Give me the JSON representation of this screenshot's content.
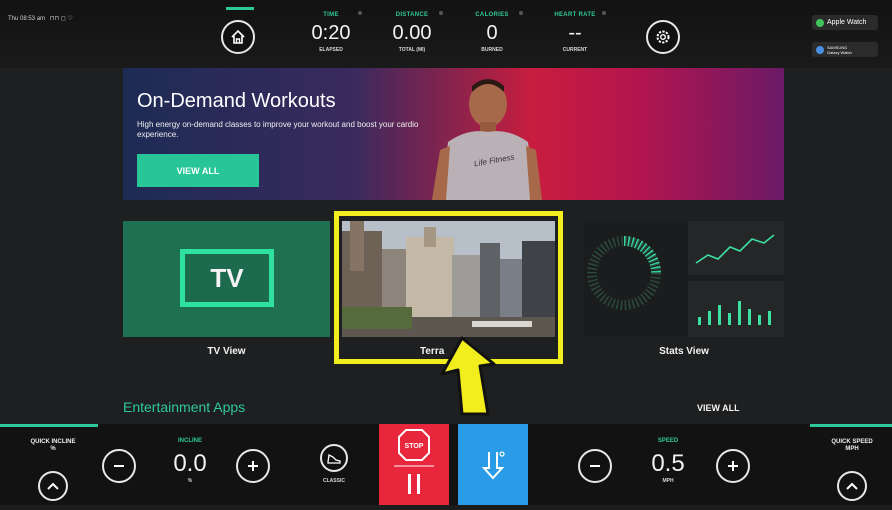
{
  "system": {
    "status_text": "Thu 08:53 am"
  },
  "stats": [
    {
      "label": "TIME",
      "value": "0:20",
      "sub": "ELAPSED"
    },
    {
      "label": "DISTANCE",
      "value": "0.00",
      "sub": "TOTAL (MI)"
    },
    {
      "label": "CALORIES",
      "value": "0",
      "sub": "BURNED"
    },
    {
      "label": "HEART RATE",
      "value": "--",
      "sub": "CURRENT"
    }
  ],
  "watches": {
    "apple": "Apple Watch",
    "samsung_line1": "SAMSUNG",
    "samsung_line2": "Galaxy Watch"
  },
  "hero": {
    "title": "On-Demand Workouts",
    "description": "High energy on-demand classes to improve your workout and boost your cardio experience.",
    "button": "VIEW ALL",
    "shirt_brand": "Life Fitness"
  },
  "tiles": {
    "tv_icon_text": "TV",
    "tv_label": "TV View",
    "terrain_label": "Terra",
    "stats_label": "Stats View"
  },
  "entertainment": {
    "title": "Entertainment Apps",
    "view_all": "VIEW ALL"
  },
  "bottom": {
    "quick_incline": "QUICK INCLINE",
    "quick_incline_unit": "%",
    "incline_label": "INCLINE",
    "incline_value": "0.0",
    "incline_unit": "%",
    "classic_label": "CLASSIC",
    "stop_label": "STOP",
    "speed_label": "SPEED",
    "speed_value": "0.5",
    "speed_unit": "MPH",
    "quick_speed": "QUICK SPEED",
    "quick_speed_unit": "MPH"
  },
  "colors": {
    "accent": "#2ec99a",
    "stop": "#e8273d",
    "nav": "#2a9be6",
    "highlight": "#f2ee1d"
  }
}
